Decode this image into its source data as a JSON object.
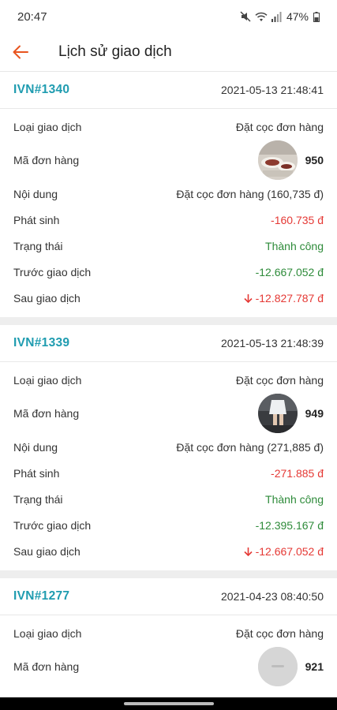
{
  "status_bar": {
    "time": "20:47",
    "battery": "47%"
  },
  "app_bar": {
    "title": "Lịch sử giao dịch"
  },
  "labels": {
    "type": "Loại giao dịch",
    "order": "Mã đơn hàng",
    "content": "Nội dung",
    "amount": "Phát sinh",
    "status": "Trạng thái",
    "before": "Trước giao dịch",
    "after": "Sau giao dịch"
  },
  "transactions": [
    {
      "id": "IVN#1340",
      "time": "2021-05-13 21:48:41",
      "type": "Đặt cọc đơn hàng",
      "order_no": "950",
      "content": "Đặt cọc đơn hàng (160,735 đ)",
      "amount": "-160.735 đ",
      "status": "Thành công",
      "before": "-12.667.052 đ",
      "after": "-12.827.787 đ"
    },
    {
      "id": "IVN#1339",
      "time": "2021-05-13 21:48:39",
      "type": "Đặt cọc đơn hàng",
      "order_no": "949",
      "content": "Đặt cọc đơn hàng (271,885 đ)",
      "amount": "-271.885 đ",
      "status": "Thành công",
      "before": "-12.395.167 đ",
      "after": "-12.667.052 đ"
    },
    {
      "id": "IVN#1277",
      "time": "2021-04-23 08:40:50",
      "type": "Đặt cọc đơn hàng",
      "order_no": "921"
    }
  ],
  "colors": {
    "accent": "#e8541e",
    "id_color": "#1f9cb0",
    "negative": "#e53935",
    "positive": "#2e8b3a"
  },
  "icons": {
    "back": "arrow-left-icon",
    "down": "arrow-down-icon"
  }
}
